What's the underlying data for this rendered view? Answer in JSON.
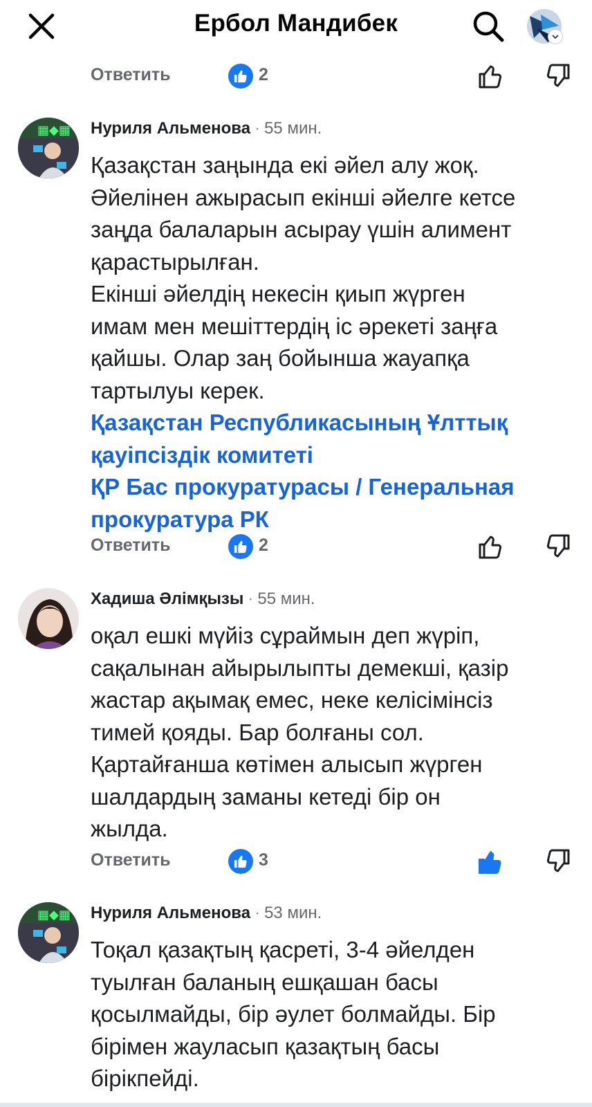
{
  "header": {
    "title": "Ербол Мандибек",
    "close_icon": "close-icon",
    "search_icon": "search-icon"
  },
  "colors": {
    "accent": "#1877f2",
    "mention": "#1664d9",
    "secondary_text": "#65676b"
  },
  "top_actions": {
    "reply_label": "Ответить",
    "like_count": "2",
    "liked": false
  },
  "comments": [
    {
      "author": "Нуриля Альменова",
      "time": "55 мин.",
      "lines": [
        "Қазақстан заңында екі әйел алу жоқ.",
        "Әйелінен ажырасып екінші әйелге кетсе",
        "заңда балаларын асырау үшін алимент",
        "қарастырылған.",
        "Екінші әйелдің некесін қиып жүрген",
        "имам мен мешіттердің іс әрекеті заңға",
        "қайшы. Олар заң бойынша жауапқа",
        "тартылуы керек."
      ],
      "mention_lines": [
        "Қазақстан Республикасының Ұлттық",
        "қауіпсіздік комитеті",
        "ҚР Бас прокуратурасы /  Генеральная",
        "прокуратура РК"
      ],
      "reply_label": "Ответить",
      "like_count": "2",
      "liked": false
    },
    {
      "author": "Хадиша Әлімқызы",
      "time": "55 мин.",
      "lines": [
        "оқал ешкі мүйіз сұраймын деп жүріп,",
        "сақалынан айырылыпты демекші, қазір",
        "жастар ақымақ емес, неке келісімінсіз",
        "тимей қояды. Бар болғаны сол.",
        "Қартайғанша көтімен алысып жүрген",
        "шалдардың заманы кетеді бір он",
        "жылда."
      ],
      "reply_label": "Ответить",
      "like_count": "3",
      "liked": true
    },
    {
      "author": "Нуриля Альменова",
      "time": "53 мин.",
      "lines": [
        "Тоқал қазақтың қасреті, 3-4 әйелден",
        "туылған баланың ешқашан басы",
        "қосылмайды, бір әулет болмайды. Бір",
        "бірімен жауласып қазақтың басы",
        "бірікпейді."
      ]
    }
  ]
}
